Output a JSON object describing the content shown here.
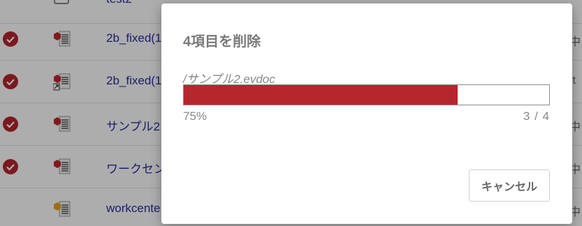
{
  "file_list": {
    "rows": [
      {
        "name": "test2",
        "selected": false,
        "icon": "evdoc-file-icon"
      },
      {
        "name": "2b_fixed(1",
        "selected": true,
        "icon": "evdoc-file-icon",
        "right": "中"
      },
      {
        "name": "2b_fixed(1",
        "selected": true,
        "icon": "evdoc-shortcut-icon",
        "right": "ft"
      },
      {
        "name": "サンプル2",
        "selected": true,
        "icon": "evdoc-file-icon",
        "right": "中"
      },
      {
        "name": "ワークセン",
        "selected": true,
        "icon": "evdoc-file-icon",
        "right": "中"
      },
      {
        "name": "workcente",
        "selected": false,
        "icon": "evdoc-file-icon-yellow",
        "right": "中"
      }
    ]
  },
  "dialog": {
    "title": "4項目を削除",
    "current_file": "/サンプル2.evdoc",
    "progress_percent": 75,
    "percent_label": "75%",
    "count_label": "3 / 4",
    "cancel_label": "キャンセル"
  },
  "colors": {
    "accent": "#b5262d",
    "link": "#2a2aa0",
    "overlay": "rgba(0,0,0,0.32)"
  }
}
